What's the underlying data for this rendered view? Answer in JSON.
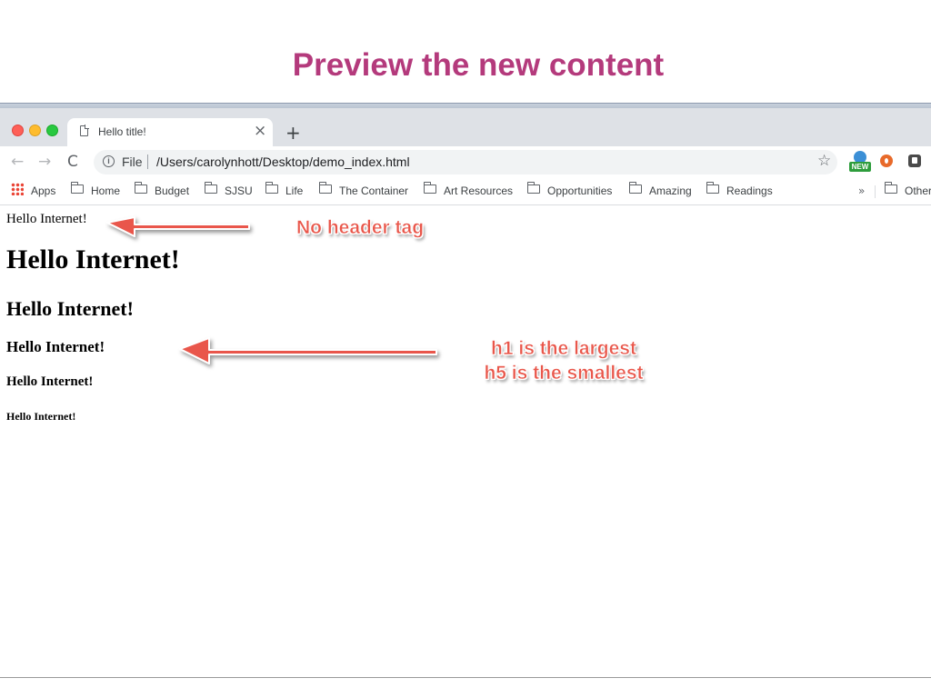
{
  "slide": {
    "title": "Preview the new content"
  },
  "browser": {
    "tab_title": "Hello title!",
    "tab_close_glyph": "×",
    "new_tab_glyph": "+",
    "back_glyph": "←",
    "forward_glyph": "→",
    "reload_glyph": "C",
    "info_glyph": "i",
    "scheme_label": "File",
    "url": "/Users/carolynhott/Desktop/demo_index.html",
    "star_glyph": "☆",
    "extension_badge": "NEW",
    "bookmarks": [
      {
        "label": "Apps",
        "icon": "apps-grid-icon"
      },
      {
        "label": "Home",
        "icon": "folder-icon"
      },
      {
        "label": "Budget",
        "icon": "folder-icon"
      },
      {
        "label": "SJSU",
        "icon": "folder-icon"
      },
      {
        "label": "Life",
        "icon": "folder-icon"
      },
      {
        "label": "The Container",
        "icon": "folder-icon"
      },
      {
        "label": "Art Resources",
        "icon": "folder-icon"
      },
      {
        "label": "Opportunities",
        "icon": "folder-icon"
      },
      {
        "label": "Amazing",
        "icon": "folder-icon"
      },
      {
        "label": "Readings",
        "icon": "folder-icon"
      },
      {
        "label": "Other",
        "icon": "folder-icon"
      }
    ],
    "bookmarks_overflow_glyph": "»"
  },
  "page": {
    "paragraph": "Hello Internet!",
    "h1": "Hello Internet!",
    "h2": "Hello Internet!",
    "h3": "Hello Internet!",
    "h4": "Hello Internet!",
    "h5": "Hello Internet!"
  },
  "annotations": {
    "no_header": "No header tag",
    "sizes_line1": "h1 is the largest",
    "sizes_line2": "h5 is the smallest"
  },
  "colors": {
    "title": "#b43a7c",
    "annotation": "#e9574b"
  }
}
